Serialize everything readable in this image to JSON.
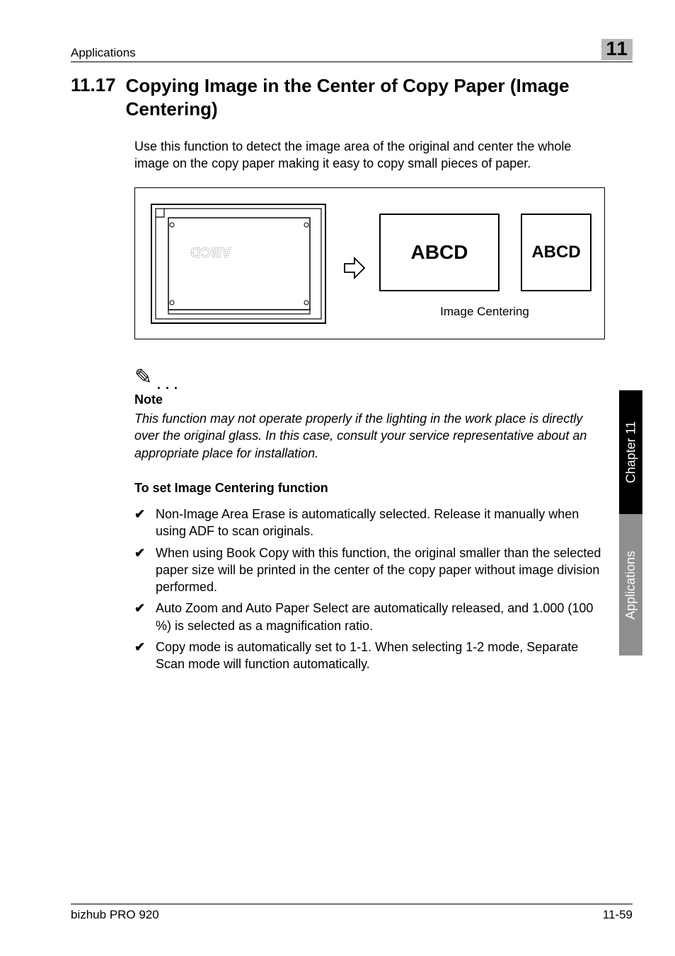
{
  "header": {
    "left": "Applications",
    "badge": "11"
  },
  "section": {
    "number": "11.17",
    "title": "Copying Image in the Center of Copy Paper (Image Centering)"
  },
  "intro": "Use this function to detect the image area of the original and center the whole image on the copy paper making it easy to copy small pieces of paper.",
  "figure": {
    "scanner_text": "ABCD",
    "result1": "ABCD",
    "result2": "ABCD",
    "caption": "Image Centering"
  },
  "note": {
    "heading": "Note",
    "body": "This function may not operate properly if the lighting in the work place is directly over the original glass. In this case, consult your service representative about an appropriate place for installation."
  },
  "subheading": "To set Image Centering function",
  "checks": [
    "Non-Image Area Erase is automatically selected. Release it manually when using ADF to scan originals.",
    "When using Book Copy with this function, the original smaller than the selected paper size will be printed in the center of the copy paper without image division performed.",
    "Auto Zoom and Auto Paper Select are automatically released, and 1.000 (100 %) is selected as a magnification ratio.",
    "Copy mode is automatically set to 1-1. When selecting 1-2 mode, Separate Scan mode will function automatically."
  ],
  "sidetabs": {
    "dark": "Chapter 11",
    "light": "Applications"
  },
  "footer": {
    "left": "bizhub PRO 920",
    "right": "11-59"
  }
}
